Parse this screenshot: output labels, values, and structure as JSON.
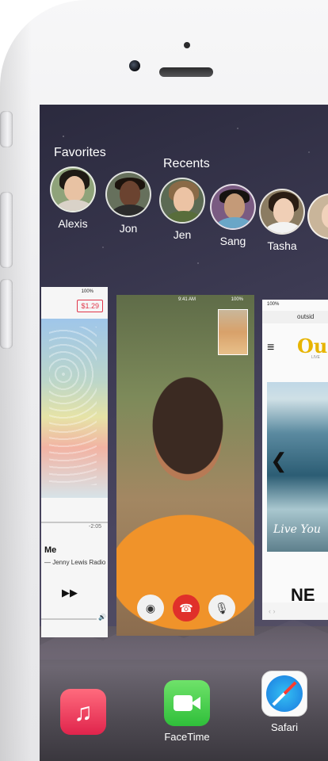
{
  "contacts": {
    "favorites_label": "Favorites",
    "recents_label": "Recents",
    "people": [
      {
        "name": "Alexis"
      },
      {
        "name": "Jon"
      },
      {
        "name": "Jen"
      },
      {
        "name": "Sang"
      },
      {
        "name": "Tasha"
      }
    ]
  },
  "music_card": {
    "status_battery": "100%",
    "price": "$1.29",
    "elapsed": "-2:05",
    "song_title": "Me",
    "artist": "— Jenny Lewis Radio",
    "forward_glyph": "▶▶"
  },
  "facetime_card": {
    "status_time": "9:41 AM",
    "status_battery": "100%"
  },
  "safari_card": {
    "status_battery": "100%",
    "url": "outsid",
    "logo": "Ou",
    "logo_sub": "LIVE",
    "caption": "Live You",
    "big_text": "NE",
    "menu_glyph": "≡",
    "back_glyph": "❮",
    "toolbar_glyphs": "‹   ›"
  },
  "dock": [
    {
      "label": "",
      "icon": "music-icon"
    },
    {
      "label": "FaceTime",
      "icon": "facetime-icon"
    },
    {
      "label": "Safari",
      "icon": "safari-icon"
    }
  ],
  "colors": {
    "music_red": "#e0244c",
    "facetime_green": "#2fbf3a",
    "end_call_red": "#e0302a",
    "price_red": "#e0364a"
  }
}
